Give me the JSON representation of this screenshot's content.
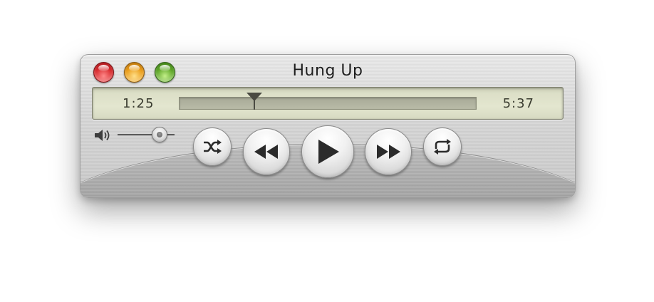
{
  "window": {
    "title": "Hung Up"
  },
  "title_bar": {
    "buttons": [
      {
        "name": "close",
        "color": "#d6282c"
      },
      {
        "name": "minimize",
        "color": "#e99a14"
      },
      {
        "name": "zoom",
        "color": "#5aa323"
      }
    ]
  },
  "display": {
    "elapsed": "1:25",
    "total": "5:37",
    "progress": 0.252
  },
  "volume": {
    "icon": "speaker-icon",
    "level": 0.72
  },
  "controls": [
    {
      "name": "shuffle",
      "icon": "shuffle-icon"
    },
    {
      "name": "previous",
      "icon": "rewind-icon"
    },
    {
      "name": "play",
      "icon": "play-icon"
    },
    {
      "name": "next",
      "icon": "fast-forward-icon"
    },
    {
      "name": "repeat",
      "icon": "repeat-icon"
    }
  ],
  "colors": {
    "lcd_background": "#e3e6cf",
    "lcd_text": "#3a3c30",
    "metal": "#d6d6d6"
  }
}
